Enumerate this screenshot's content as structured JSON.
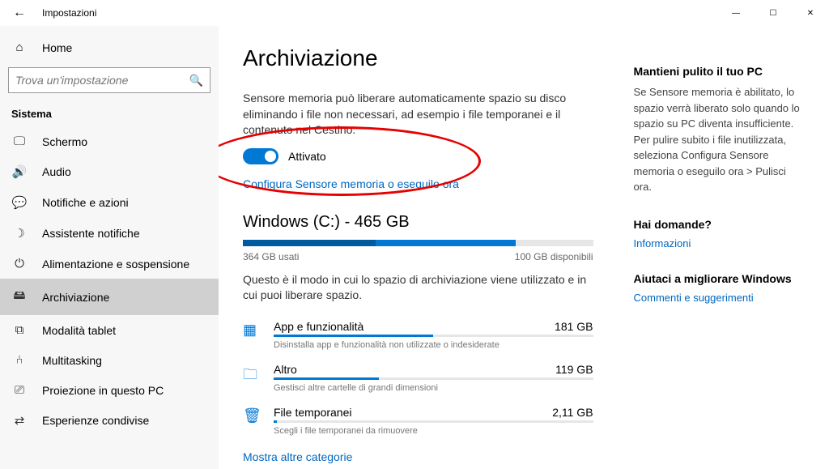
{
  "titlebar": {
    "back_icon": "←",
    "title": "Impostazioni",
    "min": "—",
    "max": "☐",
    "close": "✕"
  },
  "sidebar": {
    "home_icon": "⌂",
    "home_label": "Home",
    "search_placeholder": "Trova un'impostazione",
    "search_icon": "🔍",
    "section": "Sistema",
    "items": [
      {
        "icon": "🖵",
        "label": "Schermo"
      },
      {
        "icon": "🔊",
        "label": "Audio"
      },
      {
        "icon": "💬",
        "label": "Notifiche e azioni"
      },
      {
        "icon": "☽",
        "label": "Assistente notifiche"
      },
      {
        "icon": "⏻",
        "label": "Alimentazione e sospensione"
      },
      {
        "icon": "🖴",
        "label": "Archiviazione"
      },
      {
        "icon": "⧉",
        "label": "Modalità tablet"
      },
      {
        "icon": "⑃",
        "label": "Multitasking"
      },
      {
        "icon": "⎚",
        "label": "Proiezione in questo PC"
      },
      {
        "icon": "⇄",
        "label": "Esperienze condivise"
      }
    ],
    "active_index": 5
  },
  "content": {
    "title": "Archiviazione",
    "desc": "Sensore memoria può liberare automaticamente spazio su disco eliminando i file non necessari, ad esempio i file temporanei e il contenuto nel Cestino.",
    "toggle_state": "Attivato",
    "configure_link": "Configura Sensore memoria o eseguilo ora",
    "drive_title": "Windows (C:) - 465 GB",
    "used_pct": 78,
    "used_dark_pct": 38,
    "used_text": "364 GB usati",
    "free_text": "100 GB disponibili",
    "drive_desc": "Questo è il modo in cui lo spazio di archiviazione viene utilizzato e in cui puoi liberare spazio.",
    "categories": [
      {
        "icon": "▦",
        "label": "App e funzionalità",
        "size": "181 GB",
        "pct": 50,
        "sub": "Disinstalla app e funzionalità non utilizzate o indesiderate"
      },
      {
        "icon": "🗀",
        "label": "Altro",
        "size": "119 GB",
        "pct": 33,
        "sub": "Gestisci altre cartelle di grandi dimensioni"
      },
      {
        "icon": "🗑",
        "label": "File temporanei",
        "size": "2,11 GB",
        "pct": 1,
        "sub": "Scegli i file temporanei da rimuovere"
      }
    ],
    "more_link": "Mostra altre categorie"
  },
  "aside": {
    "title1": "Mantieni pulito il tuo PC",
    "text1": "Se Sensore memoria è abilitato, lo spazio verrà liberato solo quando lo spazio su PC diventa insufficiente. Per pulire subito i file inutilizzata, seleziona Configura Sensore memoria o eseguilo ora > Pulisci ora.",
    "title2": "Hai domande?",
    "link2": "Informazioni",
    "title3": "Aiutaci a migliorare Windows",
    "link3": "Commenti e suggerimenti"
  }
}
